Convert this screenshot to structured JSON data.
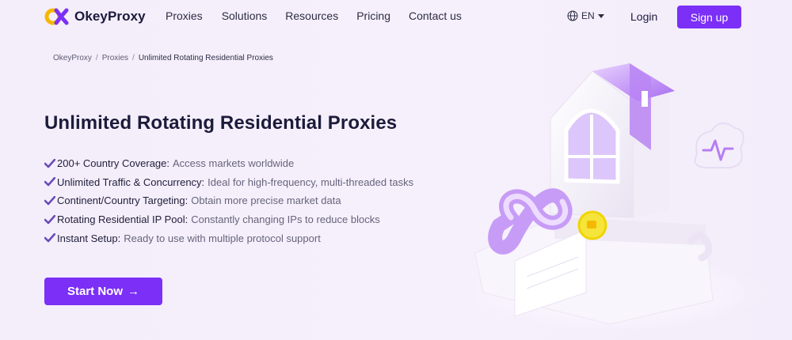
{
  "brand": {
    "name": "OkeyProxy"
  },
  "nav": {
    "menu": [
      "Proxies",
      "Solutions",
      "Resources",
      "Pricing",
      "Contact us"
    ],
    "language": "EN",
    "login": "Login",
    "signup": "Sign up"
  },
  "breadcrumb": [
    "OkeyProxy",
    "Proxies",
    "Unlimited Rotating Residential Proxies"
  ],
  "hero": {
    "title": "Unlimited Rotating Residential Proxies",
    "features": [
      {
        "label": "200+ Country Coverage:",
        "desc": "Access markets worldwide"
      },
      {
        "label": "Unlimited Traffic & Concurrency:",
        "desc": "Ideal for high-frequency, multi-threaded tasks"
      },
      {
        "label": "Continent/Country Targeting:",
        "desc": "Obtain more precise market data"
      },
      {
        "label": "Rotating Residential IP Pool:",
        "desc": "Constantly changing IPs to reduce blocks"
      },
      {
        "label": "Instant Setup:",
        "desc": "Ready to use with multiple protocol support"
      }
    ],
    "cta": "Start Now",
    "cta_arrow": "→"
  },
  "colors": {
    "accent": "#7b2ff7",
    "check": "#6a4bb8",
    "background": "#f5effb"
  },
  "icons": [
    "globe-icon",
    "caret-down-icon",
    "check-icon",
    "arrow-right-icon"
  ]
}
